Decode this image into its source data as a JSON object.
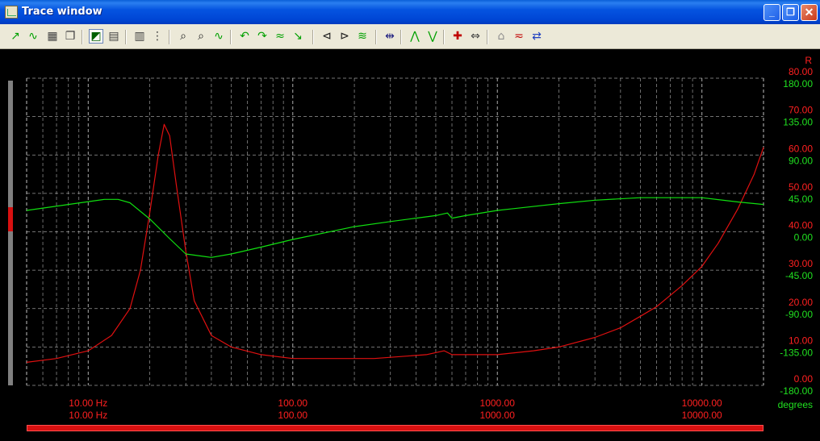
{
  "window": {
    "title": "Trace window",
    "icon": "trace-app-icon",
    "controls": {
      "minimize": "_",
      "maximize": "❐",
      "close": "✕"
    }
  },
  "toolbar": {
    "items": [
      {
        "name": "add-trace-icon",
        "glyph": "↗",
        "color": "#00a000"
      },
      {
        "name": "trace-options-icon",
        "glyph": "∿",
        "color": "#00a000"
      },
      {
        "name": "save-icon",
        "glyph": "▦",
        "color": "#404040"
      },
      {
        "name": "copy-icon",
        "glyph": "❐",
        "color": "#404040"
      },
      {
        "name": "trace-view-icon",
        "glyph": "◩",
        "color": "#006000",
        "active": true
      },
      {
        "name": "table-view-icon",
        "glyph": "▤",
        "color": "#404040"
      },
      {
        "name": "properties-icon",
        "glyph": "▥",
        "color": "#404040"
      },
      {
        "name": "data-list-icon",
        "glyph": "⋮",
        "color": "#404040"
      },
      {
        "name": "zoom-in-icon",
        "glyph": "⌕",
        "color": "#202020"
      },
      {
        "name": "zoom-out-icon",
        "glyph": "⌕",
        "color": "#202020"
      },
      {
        "name": "auto-scale-icon",
        "glyph": "∿",
        "color": "#00a000"
      },
      {
        "name": "smooth-icon",
        "glyph": "↶",
        "color": "#00a000"
      },
      {
        "name": "undo-icon",
        "glyph": "↷",
        "color": "#00a000"
      },
      {
        "name": "average-icon",
        "glyph": "≈",
        "color": "#00a000"
      },
      {
        "name": "normalize-icon",
        "glyph": "↘",
        "color": "#00a000"
      },
      {
        "name": "marker-left-icon",
        "glyph": "⊲",
        "color": "#202020"
      },
      {
        "name": "marker-right-icon",
        "glyph": "⊳",
        "color": "#202020"
      },
      {
        "name": "fit-icon",
        "glyph": "≋",
        "color": "#00a000"
      },
      {
        "name": "scale-icon",
        "glyph": "⇹",
        "color": "#202080"
      },
      {
        "name": "peak-icon",
        "glyph": "⋀",
        "color": "#00a000"
      },
      {
        "name": "valley-icon",
        "glyph": "⋁",
        "color": "#00a000"
      },
      {
        "name": "cursor-icon",
        "glyph": "✚",
        "color": "#c00000"
      },
      {
        "name": "cursor-move-icon",
        "glyph": "⇔",
        "color": "#404040"
      },
      {
        "name": "overlay-icon",
        "glyph": "⌂",
        "color": "#909090"
      },
      {
        "name": "compare-icon",
        "glyph": "≂",
        "color": "#c00000"
      },
      {
        "name": "settings-icon",
        "glyph": "⇄",
        "color": "#2040c0"
      }
    ]
  },
  "colors": {
    "magnitude": "#e01010",
    "phase": "#10e010",
    "grid": "#c0c0c0",
    "background": "#000000"
  },
  "axes": {
    "right_top_label": "R",
    "left_y": {
      "ticks": [
        "80.00",
        "70.00",
        "60.00",
        "50.00",
        "40.00",
        "30.00",
        "20.00",
        "10.00",
        "0.00"
      ]
    },
    "right_y": {
      "ticks": [
        "180.00",
        "135.00",
        "90.00",
        "45.00",
        "0.00",
        "-45.00",
        "-90.00",
        "-135.00",
        "-180.00"
      ],
      "unit": "degrees"
    },
    "x": {
      "ticks_top": [
        "10.00 Hz",
        "100.00",
        "1000.00",
        "10000.00"
      ],
      "ticks_bottom": [
        "10.00 Hz",
        "100.00",
        "1000.00",
        "10000.00"
      ]
    }
  },
  "chart_data": {
    "type": "line",
    "x_scale": "log",
    "xlim": [
      5,
      20000
    ],
    "ylim_left": [
      0,
      80
    ],
    "ylim_right": [
      -180,
      180
    ],
    "grid": true,
    "series": [
      {
        "axis": "left",
        "x": [
          5,
          7,
          10,
          13,
          16,
          18,
          20,
          22,
          23.5,
          25,
          27,
          30,
          33,
          40,
          50,
          70,
          100,
          150,
          250,
          450,
          550,
          600,
          650,
          1000,
          1500,
          2000,
          3000,
          4000,
          5000,
          6000,
          8000,
          10000,
          12000,
          15000,
          18000,
          20000
        ],
        "y": [
          6,
          7,
          9,
          13,
          20,
          30,
          45,
          60,
          68,
          65,
          52,
          35,
          22,
          13,
          10,
          8,
          7,
          7,
          7,
          8,
          9,
          8,
          8,
          8,
          9,
          10,
          12.5,
          15,
          18,
          20.5,
          26,
          31,
          37,
          46,
          55,
          62
        ]
      },
      {
        "axis": "right",
        "x": [
          5,
          8,
          12,
          14,
          16,
          20,
          25,
          30,
          40,
          50,
          70,
          100,
          200,
          300,
          400,
          500,
          570,
          600,
          700,
          1000,
          2000,
          3000,
          5000,
          7000,
          10000,
          15000,
          20000
        ],
        "y": [
          25,
          32,
          38,
          38,
          34,
          15,
          -8,
          -26,
          -30,
          -26,
          -18,
          -9,
          6,
          12,
          16,
          19,
          22,
          16,
          19,
          25,
          33,
          37,
          40,
          40,
          40,
          35,
          32
        ]
      }
    ]
  }
}
